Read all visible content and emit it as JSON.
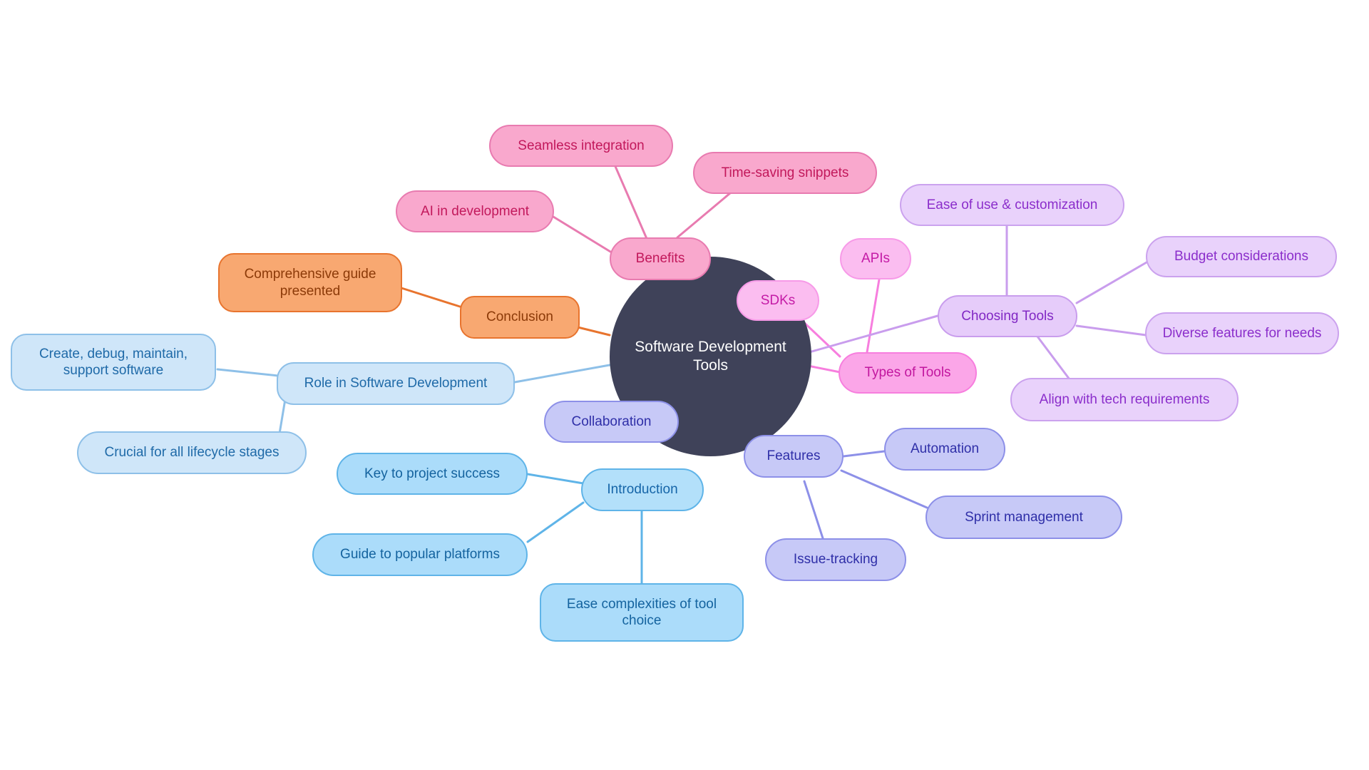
{
  "diagram": {
    "type": "mindmap",
    "title": "Software Development Tools",
    "background": "#ffffff",
    "root": {
      "label": "Software Development Tools",
      "fill": "#3f4259",
      "text_color": "#ffffff"
    },
    "branches": [
      {
        "id": "benefits",
        "label": "Benefits",
        "accent": "#e87bb0",
        "fill": "#f9a8cd",
        "text_color": "#c2185b",
        "children": [
          {
            "label": "Seamless integration"
          },
          {
            "label": "Time-saving snippets"
          },
          {
            "label": "AI in development"
          }
        ]
      },
      {
        "id": "types-of-tools",
        "label": "Types of Tools",
        "accent": "#f77ede",
        "fill": "#fba6e8",
        "text_color": "#c2179f",
        "children": [
          {
            "label": "SDKs"
          },
          {
            "label": "APIs"
          }
        ]
      },
      {
        "id": "choosing-tools",
        "label": "Choosing Tools",
        "accent": "#c99ded",
        "fill": "#e6ccfa",
        "text_color": "#8128c4",
        "children": [
          {
            "label": "Ease of use & customization"
          },
          {
            "label": "Budget considerations"
          },
          {
            "label": "Diverse features for needs"
          },
          {
            "label": "Align with tech requirements"
          }
        ]
      },
      {
        "id": "features",
        "label": "Features",
        "accent": "#8d90e8",
        "fill": "#c7c9f7",
        "text_color": "#2f2fa8",
        "children": [
          {
            "label": "Automation"
          },
          {
            "label": "Sprint management"
          },
          {
            "label": "Issue-tracking"
          },
          {
            "label": "Collaboration"
          }
        ]
      },
      {
        "id": "introduction",
        "label": "Introduction",
        "accent": "#5fb4e8",
        "fill": "#b3e0fa",
        "text_color": "#1565a8",
        "children": [
          {
            "label": "Key to project success"
          },
          {
            "label": "Guide to popular platforms"
          },
          {
            "label": "Ease complexities of tool\nchoice"
          }
        ]
      },
      {
        "id": "role-in-software-development",
        "label": "Role in Software Development",
        "accent": "#8ec0e8",
        "fill": "#cfe6f9",
        "text_color": "#1f6aa8",
        "children": [
          {
            "label": "Create, debug, maintain,\nsupport software"
          },
          {
            "label": "Crucial for all lifecycle stages"
          }
        ]
      },
      {
        "id": "conclusion",
        "label": "Conclusion",
        "accent": "#e8742e",
        "fill": "#f8a871",
        "text_color": "#8c3a08",
        "children": [
          {
            "label": "Comprehensive guide\npresented"
          }
        ]
      }
    ]
  },
  "nodes": {
    "root": {
      "label": "Software Development Tools"
    },
    "benefits": {
      "label": "Benefits"
    },
    "seamless_integration": {
      "label": "Seamless integration"
    },
    "time_saving_snippets": {
      "label": "Time-saving snippets"
    },
    "ai_in_development": {
      "label": "AI in development"
    },
    "types_of_tools": {
      "label": "Types of Tools"
    },
    "sdks": {
      "label": "SDKs"
    },
    "apis": {
      "label": "APIs"
    },
    "choosing_tools": {
      "label": "Choosing Tools"
    },
    "ease_of_use": {
      "label": "Ease of use & customization"
    },
    "budget_considerations": {
      "label": "Budget considerations"
    },
    "diverse_features": {
      "label": "Diverse features for needs"
    },
    "align_tech_requirements": {
      "label": "Align with tech requirements"
    },
    "features": {
      "label": "Features"
    },
    "automation": {
      "label": "Automation"
    },
    "sprint_management": {
      "label": "Sprint management"
    },
    "issue_tracking": {
      "label": "Issue-tracking"
    },
    "collaboration": {
      "label": "Collaboration"
    },
    "introduction": {
      "label": "Introduction"
    },
    "key_to_project_success": {
      "label": "Key to project success"
    },
    "guide_to_popular": {
      "label": "Guide to popular platforms"
    },
    "ease_complexities": {
      "label": "Ease complexities of tool\nchoice"
    },
    "role_in_software_dev": {
      "label": "Role in Software Development"
    },
    "create_debug_maintain": {
      "label": "Create, debug, maintain,\nsupport software"
    },
    "crucial_lifecycle": {
      "label": "Crucial for all lifecycle stages"
    },
    "conclusion": {
      "label": "Conclusion"
    },
    "comprehensive_guide": {
      "label": "Comprehensive guide\npresented"
    }
  }
}
